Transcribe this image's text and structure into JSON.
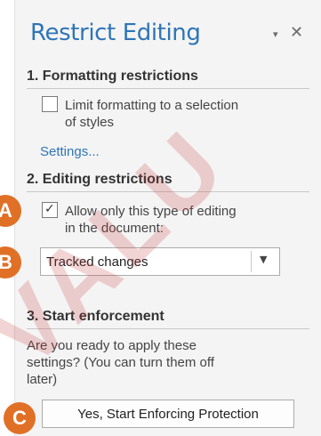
{
  "pane": {
    "title": "Restrict Editing",
    "dropdown_icon": "▾",
    "close_icon": "✕"
  },
  "formatting": {
    "heading": "1. Formatting restrictions",
    "checkbox_label_line1": "Limit formatting to a selection",
    "checkbox_label_line2": "of styles",
    "checked": false,
    "settings_link": "Settings..."
  },
  "editing": {
    "heading": "2. Editing restrictions",
    "checkbox_label_line1": "Allow only this type of editing",
    "checkbox_label_line2": "in the document:",
    "checked": true,
    "select_value": "Tracked changes"
  },
  "enforcement": {
    "heading": "3. Start enforcement",
    "text_line1": "Are you ready to apply these",
    "text_line2": "settings? (You can turn them off",
    "text_line3": "later)",
    "button_label": "Yes, Start Enforcing Protection"
  },
  "markers": [
    "A",
    "B",
    "C"
  ],
  "watermark": "VALU",
  "colors": {
    "accent": "#2e75b6",
    "marker": "#e07026",
    "pane_bg": "#f4f4f4"
  }
}
